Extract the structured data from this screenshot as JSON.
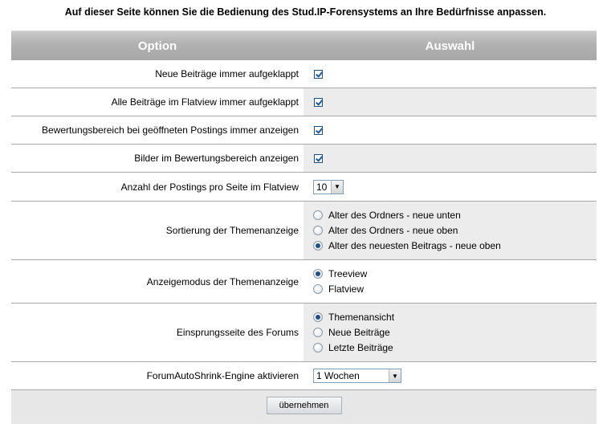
{
  "intro": "Auf dieser Seite können Sie die Bedienung des Stud.IP-Forensystems an Ihre Bedürfnisse anpassen.",
  "header": {
    "option": "Option",
    "auswahl": "Auswahl"
  },
  "rows": [
    {
      "label": "Neue Beiträge immer aufgeklappt",
      "checked": true
    },
    {
      "label": "Alle Beiträge im Flatview immer aufgeklappt",
      "checked": true
    },
    {
      "label": "Bewertungsbereich bei geöffneten Postings immer anzeigen",
      "checked": true
    },
    {
      "label": "Bilder im Bewertungsbereich anzeigen",
      "checked": true
    },
    {
      "label": "Anzahl der Postings pro Seite im Flatview",
      "selected": "10"
    },
    {
      "label": "Sortierung der Themenanzeige",
      "options": [
        "Alter des Ordners - neue unten",
        "Alter des Ordners - neue oben",
        "Alter des neuesten Beitrags - neue oben"
      ],
      "selected_index": 2
    },
    {
      "label": "Anzeigemodus der Themenanzeige",
      "options": [
        "Treeview",
        "Flatview"
      ],
      "selected_index": 0
    },
    {
      "label": "Einsprungsseite des Forums",
      "options": [
        "Themenansicht",
        "Neue Beiträge",
        "Letzte Beiträge"
      ],
      "selected_index": 0
    },
    {
      "label": "ForumAutoShrink-Engine aktivieren",
      "selected": "1 Wochen"
    }
  ],
  "submit_label": "übernehmen"
}
